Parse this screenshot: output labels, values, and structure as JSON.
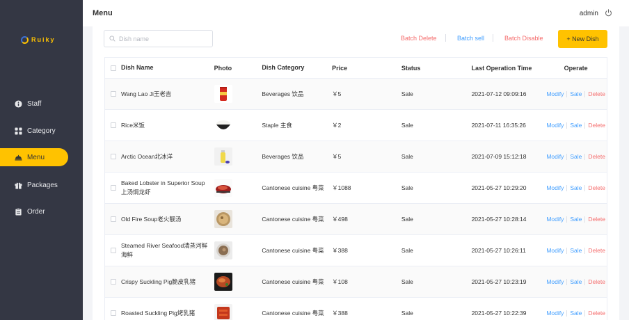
{
  "app": {
    "logo_text": "Ruiky"
  },
  "sidebar": {
    "items": [
      {
        "label": "Staff",
        "icon": "info-icon"
      },
      {
        "label": "Category",
        "icon": "grid-icon"
      },
      {
        "label": "Menu",
        "icon": "menu-icon",
        "active": true
      },
      {
        "label": "Packages",
        "icon": "gift-icon"
      },
      {
        "label": "Order",
        "icon": "order-icon"
      }
    ]
  },
  "header": {
    "title": "Menu",
    "user": "admin",
    "power_icon": "power-icon"
  },
  "toolbar": {
    "search_placeholder": "Dish name",
    "batch_delete": "Batch Delete",
    "batch_sell": "Batch sell",
    "batch_disable": "Batch Disable",
    "new_dish": "+ New Dish"
  },
  "table": {
    "headers": [
      "Dish Name",
      "Photo",
      "Dish Category",
      "Price",
      "Status",
      "Last Operation Time",
      "Operate"
    ],
    "ops": {
      "modify": "Modify",
      "sale": "Sale",
      "delete": "Delete"
    },
    "rows": [
      {
        "name": "Wang Lao Ji王老吉",
        "category": "Beverages 饮品",
        "price": "￥5",
        "status": "Sale",
        "time": "2021-07-12 09:09:16",
        "photo": "can"
      },
      {
        "name": "Rice米饭",
        "category": "Staple 主食",
        "price": "￥2",
        "status": "Sale",
        "time": "2021-07-11 16:35:26",
        "photo": "rice"
      },
      {
        "name": "Arctic Ocean北冰洋",
        "category": "Beverages 饮品",
        "price": "￥5",
        "status": "Sale",
        "time": "2021-07-09 15:12:18",
        "photo": "bottle"
      },
      {
        "name": "Baked Lobster in Superior Soup上汤焗龙虾",
        "category": "Cantonese cuisine 粤菜",
        "price": "￥1088",
        "status": "Sale",
        "time": "2021-05-27 10:29:20",
        "photo": "lobster"
      },
      {
        "name": "Old Fire Soup老火靓汤",
        "category": "Cantonese cuisine 粤菜",
        "price": "￥498",
        "status": "Sale",
        "time": "2021-05-27 10:28:14",
        "photo": "soup"
      },
      {
        "name": "Steamed River Seafood清蒸河鲜海鲜",
        "category": "Cantonese cuisine 粤菜",
        "price": "￥388",
        "status": "Sale",
        "time": "2021-05-27 10:26:11",
        "photo": "bowl"
      },
      {
        "name": "Crispy Suckling Pig脆皮乳猪",
        "category": "Cantonese cuisine 粤菜",
        "price": "￥108",
        "status": "Sale",
        "time": "2021-05-27 10:23:19",
        "photo": "pig"
      },
      {
        "name": "Roasted Suckling Pig烤乳猪",
        "category": "Cantonese cuisine 粤菜",
        "price": "￥388",
        "status": "Sale",
        "time": "2021-05-27 10:22:39",
        "photo": "roast"
      }
    ]
  },
  "colors": {
    "sidebar": "#343744",
    "accent": "#ffc200",
    "link_blue": "#419eff",
    "link_red": "#f56c6c"
  }
}
